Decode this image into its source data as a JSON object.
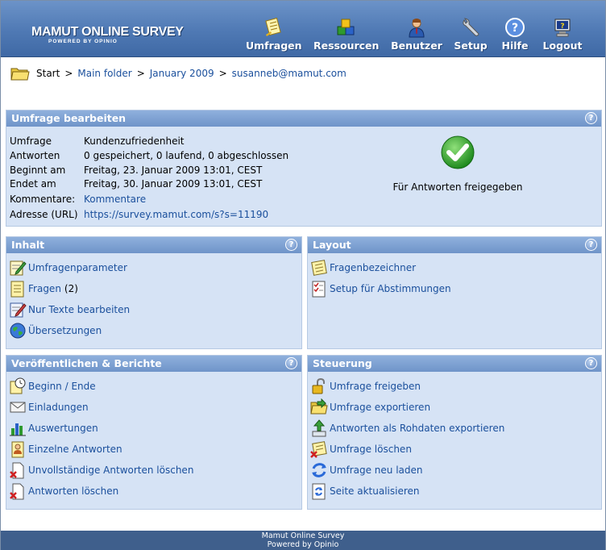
{
  "header": {
    "logo_title": "MAMUT ONLINE SURVEY",
    "logo_sub": "POWERED BY OPINIO",
    "nav": [
      {
        "label": "Umfragen",
        "icon": "survey-icon"
      },
      {
        "label": "Ressourcen",
        "icon": "resources-icon"
      },
      {
        "label": "Benutzer",
        "icon": "user-icon"
      },
      {
        "label": "Setup",
        "icon": "wrench-icon"
      },
      {
        "label": "Hilfe",
        "icon": "help-icon"
      },
      {
        "label": "Logout",
        "icon": "logout-icon"
      }
    ]
  },
  "breadcrumb": {
    "start": "Start",
    "sep": ">",
    "items": [
      "Main folder",
      "January 2009",
      "susanneb@mamut.com"
    ]
  },
  "edit_panel": {
    "title": "Umfrage bearbeiten",
    "rows": [
      {
        "key": "Umfrage",
        "value": "Kundenzufriedenheit"
      },
      {
        "key": "Antworten",
        "value": "0 gespeichert, 0 laufend, 0 abgeschlossen"
      },
      {
        "key": "Beginnt am",
        "value": "Freitag, 23. Januar 2009 13:01, CEST"
      },
      {
        "key": "Endet am",
        "value": "Freitag, 30. Januar 2009 13:01, CEST"
      },
      {
        "key": "Kommentare:",
        "value": "Kommentare"
      },
      {
        "key": "Adresse (URL)",
        "value": "https://survey.mamut.com/s?s=11190"
      }
    ],
    "status": "Für Antworten freigegeben"
  },
  "inhalt_panel": {
    "title": "Inhalt",
    "items": [
      {
        "label": "Umfragenparameter",
        "icon": "edit-params-icon"
      },
      {
        "label": "Fragen",
        "count": "(2)",
        "icon": "questions-icon"
      },
      {
        "label": "Nur Texte bearbeiten",
        "icon": "edit-text-icon"
      },
      {
        "label": "Übersetzungen",
        "icon": "globe-icon"
      }
    ]
  },
  "layout_panel": {
    "title": "Layout",
    "items": [
      {
        "label": "Fragenbezeichner",
        "icon": "question-labels-icon"
      },
      {
        "label": "Setup für Abstimmungen",
        "icon": "checklist-icon"
      }
    ]
  },
  "publish_panel": {
    "title": "Veröffentlichen & Berichte",
    "items": [
      {
        "label": "Beginn / Ende",
        "icon": "clock-icon"
      },
      {
        "label": "Einladungen",
        "icon": "envelope-icon"
      },
      {
        "label": "Auswertungen",
        "icon": "bar-chart-icon"
      },
      {
        "label": "Einzelne Antworten",
        "icon": "single-response-icon"
      },
      {
        "label": "Unvollständige Antworten löschen",
        "icon": "delete-incomplete-icon"
      },
      {
        "label": "Antworten löschen",
        "icon": "delete-responses-icon"
      }
    ]
  },
  "control_panel": {
    "title": "Steuerung",
    "items": [
      {
        "label": "Umfrage freigeben",
        "icon": "unlock-icon"
      },
      {
        "label": "Umfrage exportieren",
        "icon": "export-folder-icon"
      },
      {
        "label": "Antworten als Rohdaten exportieren",
        "icon": "export-raw-icon"
      },
      {
        "label": "Umfrage löschen",
        "icon": "delete-survey-icon"
      },
      {
        "label": "Umfrage neu laden",
        "icon": "reload-icon"
      },
      {
        "label": "Seite aktualisieren",
        "icon": "refresh-page-icon"
      }
    ]
  },
  "help_glyph": "?",
  "footer": {
    "line1": "Mamut Online Survey",
    "line2": "Powered by Opinio"
  }
}
